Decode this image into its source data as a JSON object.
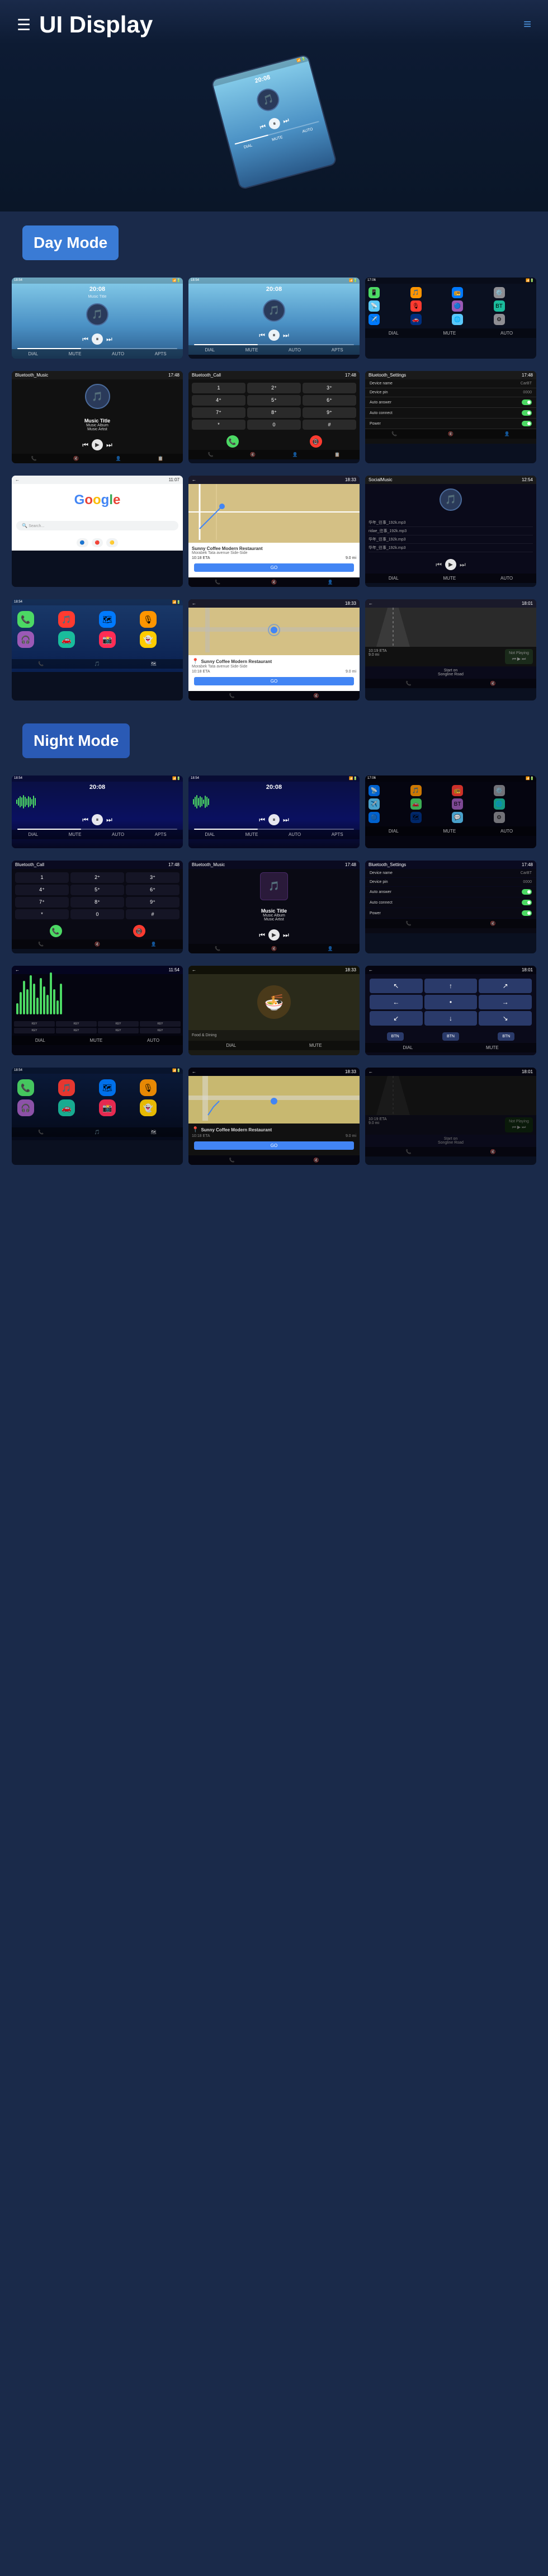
{
  "header": {
    "title": "UI Display",
    "menu_icon": "☰",
    "hamburger_icon": "≡"
  },
  "modes": {
    "day": "Day Mode",
    "night": "Night Mode"
  },
  "hero": {
    "time": "20:08"
  },
  "day_screens": [
    {
      "id": "day-music-1",
      "type": "day",
      "time": "20:08",
      "subtitle": "Music Title"
    },
    {
      "id": "day-music-2",
      "type": "day",
      "time": "20:08"
    },
    {
      "id": "day-apps",
      "type": "apps"
    },
    {
      "id": "bluetooth-music",
      "type": "bluetooth_music",
      "header": "Bluetooth_Music",
      "music_title": "Music Title",
      "music_album": "Music Album",
      "music_artist": "Music Artist"
    },
    {
      "id": "bluetooth-call",
      "type": "bluetooth_call",
      "header": "Bluetooth_Call"
    },
    {
      "id": "bluetooth-settings",
      "type": "bluetooth_settings",
      "header": "Bluetooth_Settings",
      "device_name_label": "Device name",
      "device_name_value": "CarBT",
      "device_pin_label": "Device pin",
      "device_pin_value": "0000",
      "auto_answer_label": "Auto answer",
      "auto_connect_label": "Auto connect",
      "power_label": "Power"
    },
    {
      "id": "google",
      "type": "google"
    },
    {
      "id": "map-nav",
      "type": "map"
    },
    {
      "id": "social-music",
      "type": "social",
      "header": "SocialMusic",
      "track1": "华年_往事_192k.mp3",
      "track2": "ridae_往事_192k.mp3",
      "track3": "华年_往事_192k.mp3",
      "track4": "华年_往事_192k.mp3"
    },
    {
      "id": "ios-apps",
      "type": "ios_apps"
    },
    {
      "id": "gps-nav",
      "type": "gps",
      "restaurant": "Sunny Coffee Modern Restaurant",
      "address": "Morabek Tata avenue Side-Side",
      "time": "10:18 ETA",
      "distance": "9.0 mi",
      "go_label": "GO"
    },
    {
      "id": "car-nav",
      "type": "car_nav",
      "time": "10:19 ETA",
      "distance": "9.0 mi",
      "not_playing": "Not Playing"
    }
  ],
  "night_screens": [
    {
      "id": "night-music-1",
      "type": "night",
      "time": "20:08"
    },
    {
      "id": "night-music-2",
      "type": "night",
      "time": "20:08"
    },
    {
      "id": "night-apps",
      "type": "night_apps"
    },
    {
      "id": "night-bt-call",
      "type": "night_bt_call",
      "header": "Bluetooth_Call"
    },
    {
      "id": "night-bt-music",
      "type": "night_bt_music",
      "header": "Bluetooth_Music",
      "music_title": "Music Title",
      "music_album": "Music Album",
      "music_artist": "Music Artist"
    },
    {
      "id": "night-bt-settings",
      "type": "night_bt_settings",
      "header": "Bluetooth_Settings",
      "device_name_label": "Device name",
      "device_name_value": "CarBT",
      "device_pin_label": "Device pin",
      "device_pin_value": "0000",
      "auto_answer_label": "Auto answer",
      "auto_connect_label": "Auto connect",
      "power_label": "Power"
    },
    {
      "id": "night-wave",
      "type": "night_wave"
    },
    {
      "id": "night-food",
      "type": "night_food"
    },
    {
      "id": "night-car-arrows",
      "type": "night_car_arrows"
    },
    {
      "id": "night-ios",
      "type": "night_ios_apps"
    },
    {
      "id": "night-gps",
      "type": "night_gps",
      "restaurant": "Sunny Coffee Modern Restaurant",
      "go_label": "GO",
      "time": "10:18 ETA",
      "distance": "9.0 mi"
    },
    {
      "id": "night-car-nav",
      "type": "night_car_nav",
      "time": "10:19 ETA",
      "distance": "9.0 mi",
      "not_playing": "Not Playing"
    }
  ],
  "music": {
    "title": "Music Title",
    "album": "Music Album",
    "artist": "Music Artist"
  },
  "nav": {
    "labels": [
      "DIAL",
      "MUTE",
      "CONTACTS",
      "APTS"
    ],
    "icons": [
      "📞",
      "🔇",
      "👤",
      "📋"
    ]
  }
}
